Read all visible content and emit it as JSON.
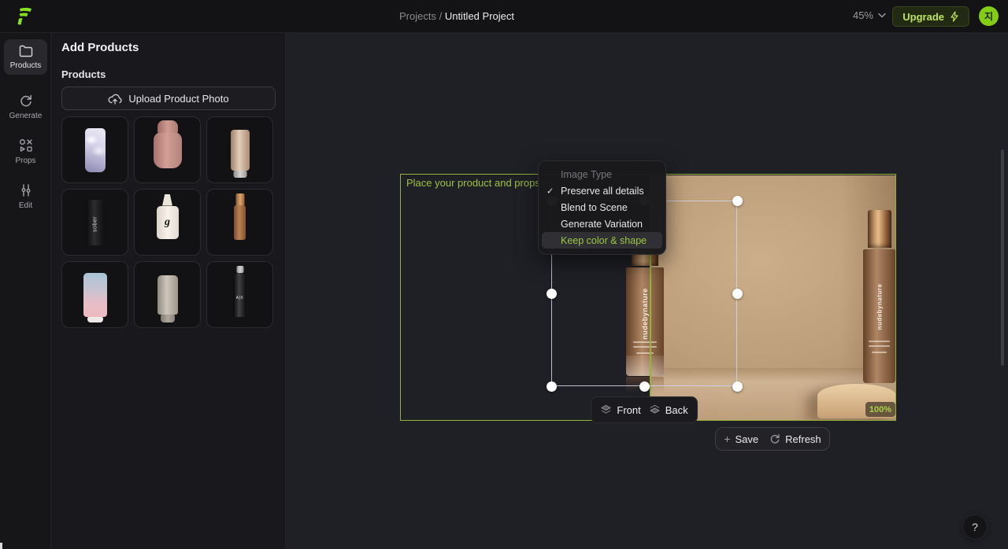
{
  "topbar": {
    "breadcrumb_prefix": "Projects /",
    "breadcrumb_current": "Untitled Project",
    "zoom_value": "45%",
    "upgrade_label": "Upgrade",
    "avatar_text": "지"
  },
  "rail": {
    "items": [
      {
        "label": "Products",
        "active": true
      },
      {
        "label": "Generate",
        "active": false
      },
      {
        "label": "Props",
        "active": false
      },
      {
        "label": "Edit",
        "active": false
      }
    ]
  },
  "panel": {
    "title": "Add Products",
    "section": "Products",
    "upload_label": "Upload Product Photo",
    "products": [
      {
        "name": "lavender cloud tube",
        "brand": ""
      },
      {
        "name": "pink cylinder bottle",
        "brand": ""
      },
      {
        "name": "beige shimmer tube",
        "brand": ""
      },
      {
        "name": "black tube",
        "brand": "sober"
      },
      {
        "name": "white dropper bottle",
        "brand": "g"
      },
      {
        "name": "tan foundation bottle",
        "brand": ""
      },
      {
        "name": "blue pink gradient tube",
        "brand": ""
      },
      {
        "name": "greige tube",
        "brand": ""
      },
      {
        "name": "black sleek bottle",
        "brand": "A|X"
      }
    ]
  },
  "canvas": {
    "placeholder": "Place your product and props h",
    "brand_text": "nudebynature",
    "menu": {
      "header": "Image Type",
      "check_glyph": "✓",
      "items": [
        {
          "label": "Preserve all details",
          "checked": true,
          "highlighted": false
        },
        {
          "label": "Blend to Scene",
          "checked": false,
          "highlighted": false
        },
        {
          "label": "Generate Variation",
          "checked": false,
          "highlighted": false
        },
        {
          "label": "Keep color & shape",
          "checked": false,
          "highlighted": true
        }
      ]
    },
    "front_label": "Front",
    "back_label": "Back",
    "zoom_badge": "100%",
    "plus_glyph": "+",
    "save_label": "Save",
    "refresh_label": "Refresh",
    "help_glyph": "?"
  },
  "colors": {
    "accent_green": "#93b33a",
    "bright_green": "#bce45b",
    "avatar_green": "#84cc16",
    "selection_stroke": "#ced3e2",
    "photo_tan": "#bd9e7a"
  }
}
